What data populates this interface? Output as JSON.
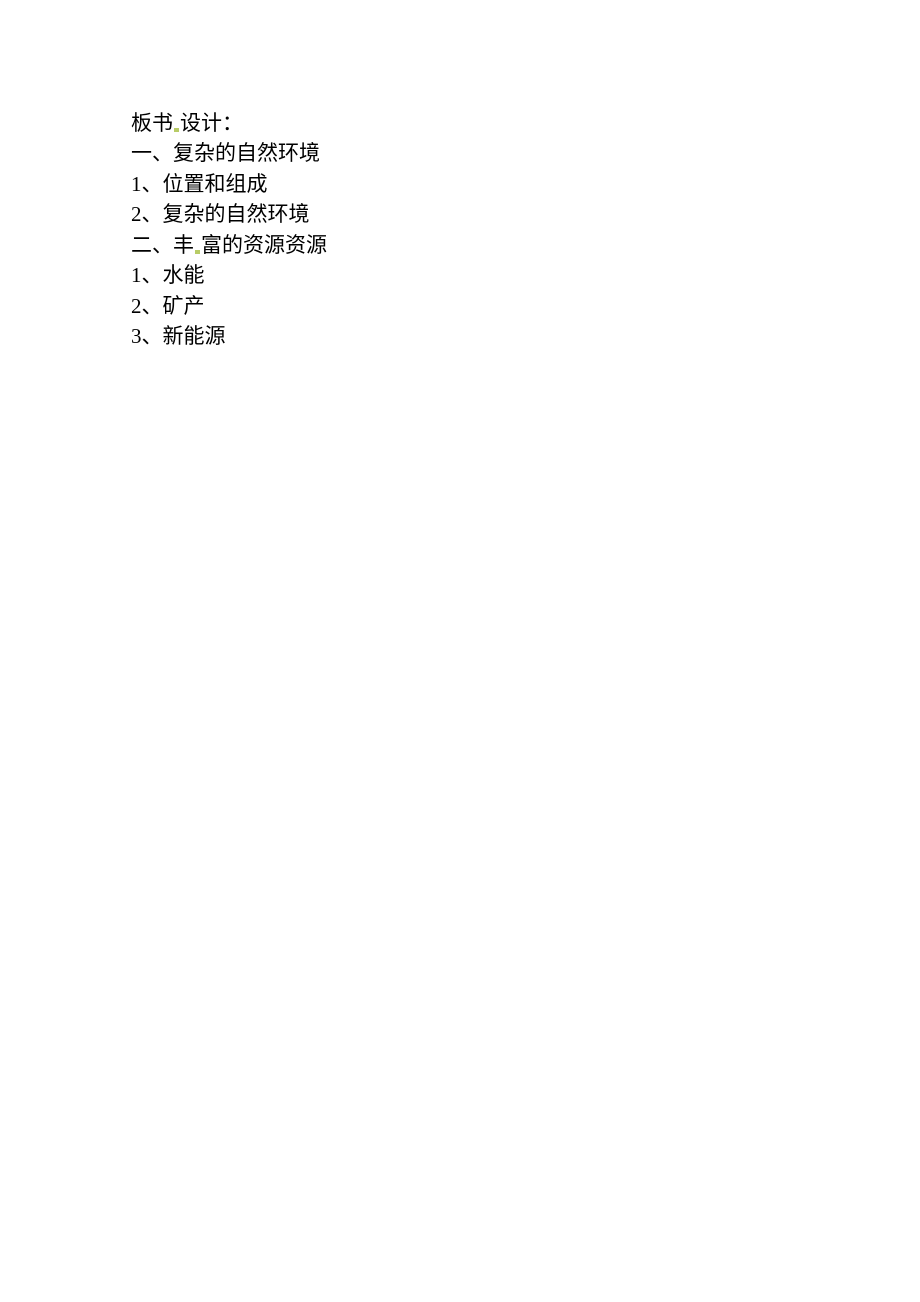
{
  "title": {
    "part1": "板书",
    "part2": "设计："
  },
  "sections": [
    {
      "heading": "一、复杂的自然环境",
      "items": [
        "1、位置和组成",
        "2、复杂的自然环境"
      ]
    },
    {
      "heading_part1": "二、丰",
      "heading_part2": "富的资源资源",
      "items": [
        "1、水能",
        "2、矿产",
        "3、新能源"
      ]
    }
  ]
}
